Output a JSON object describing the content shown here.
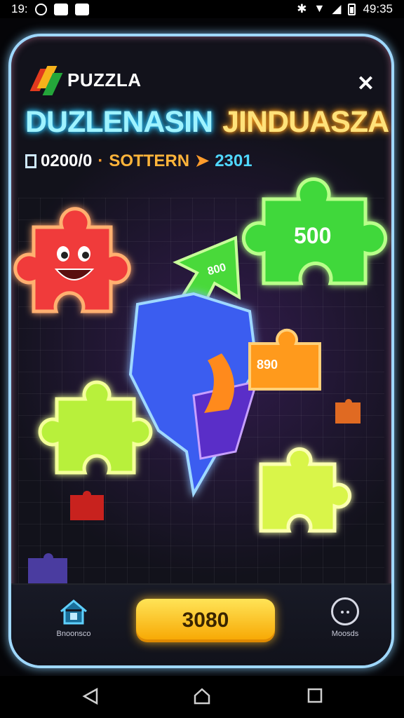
{
  "status_bar": {
    "time_left": "19:",
    "time_right": "49:35"
  },
  "app": {
    "brand": "PUZZLA",
    "close_icon": "close-icon"
  },
  "headline": {
    "part1": "DUZLENASIN",
    "part2": "JINDUASZA"
  },
  "stats": {
    "score": "0200/0",
    "label": "SOTTERN",
    "count": "2301"
  },
  "pieces": {
    "green_top_value": "500",
    "arrow_value": "800",
    "orange_value": "890"
  },
  "bottom_bar": {
    "home_label": "Bnoonsco",
    "play_label": "3080",
    "more_label": "Moosds"
  },
  "colors": {
    "accent_cyan": "#9ff3ff",
    "accent_yellow": "#ffe27a",
    "play_button": "#f7b21b",
    "card_border": "#9fd8ff"
  }
}
